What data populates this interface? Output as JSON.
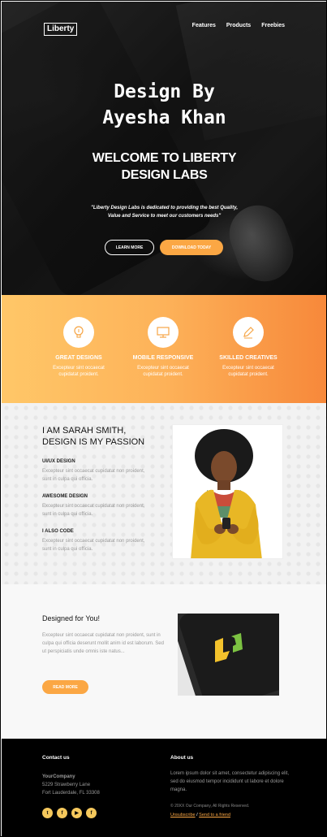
{
  "header": {
    "logo": "Liberty",
    "nav": [
      "Features",
      "Products",
      "Freebies"
    ]
  },
  "hero": {
    "designer_line1": "Design By",
    "designer_line2": "Ayesha Khan",
    "welcome_line1": "WELCOME TO LIBERTY",
    "welcome_line2": "DESIGN LABS",
    "quote_line1": "\"Liberty Design Labs is dedicated to providing the best Quality,",
    "quote_line2": "Value and Service to meet our customers needs\"",
    "learn_more": "LEARN MORE",
    "download": "DOWNLOAD TODAY"
  },
  "features": [
    {
      "title": "GREAT DESIGNS",
      "desc1": "Excepteur sint occaecat",
      "desc2": "cupidatat proident.",
      "icon": "lightbulb-icon"
    },
    {
      "title": "MOBILE RESPONSIVE",
      "desc1": "Excepteur sint occaecat",
      "desc2": "cupidatat proident.",
      "icon": "monitor-icon"
    },
    {
      "title": "SKILLED CREATIVES",
      "desc1": "Excepteur sint occaecat",
      "desc2": "cupidatat proident.",
      "icon": "pencil-icon"
    }
  ],
  "about": {
    "heading_line1": "I AM SARAH SMITH,",
    "heading_line2": "DESIGN IS MY PASSION",
    "skills": [
      {
        "title": "UI/UX DESIGN",
        "desc": "Excepteur sint occaecat cupidatat non proident, sunt in culpa qui officia."
      },
      {
        "title": "AWESOME DESIGN",
        "desc": "Excepteur sint occaecat cupidatat non proident, sunt in culpa qui officia."
      },
      {
        "title": "I ALSO CODE",
        "desc": "Excepteur sint occaecat cupidatat non proident, sunt in culpa qui officia."
      }
    ]
  },
  "designed": {
    "heading": "Designed for You!",
    "text": "Excepteur sint occaecat cupidatat non proident, sunt in culpa qui officia deserunt mollit anim id est laborum. Sed ut perspiciatis unde omnis iste natus...",
    "button": "READ MORE"
  },
  "footer": {
    "contact_heading": "Contact us",
    "company": "YourCompany",
    "address1": "5229 Strawberry Lane",
    "address2": "Fort Lauderdale, FL 33308",
    "about_heading": "About us",
    "about_text": "Lorem ipsum dolor sit amet, consectetur adipiscing elit, sed do eiusmod tempor incididunt ut labore et dolore magna.",
    "copyright": "© 20XX Our Company, All Rights Reserved.",
    "unsubscribe": "Unsubscribe",
    "separator": " / ",
    "send_friend": "Send to a friend",
    "social": [
      {
        "name": "twitter-icon",
        "glyph": "t"
      },
      {
        "name": "facebook-icon",
        "glyph": "f"
      },
      {
        "name": "youtube-icon",
        "glyph": "▶"
      },
      {
        "name": "facebook-icon",
        "glyph": "f"
      }
    ]
  },
  "colors": {
    "accent": "#fba744",
    "gradient_start": "#ffc768",
    "gradient_end": "#f7883a",
    "footer_bg": "#000000"
  }
}
